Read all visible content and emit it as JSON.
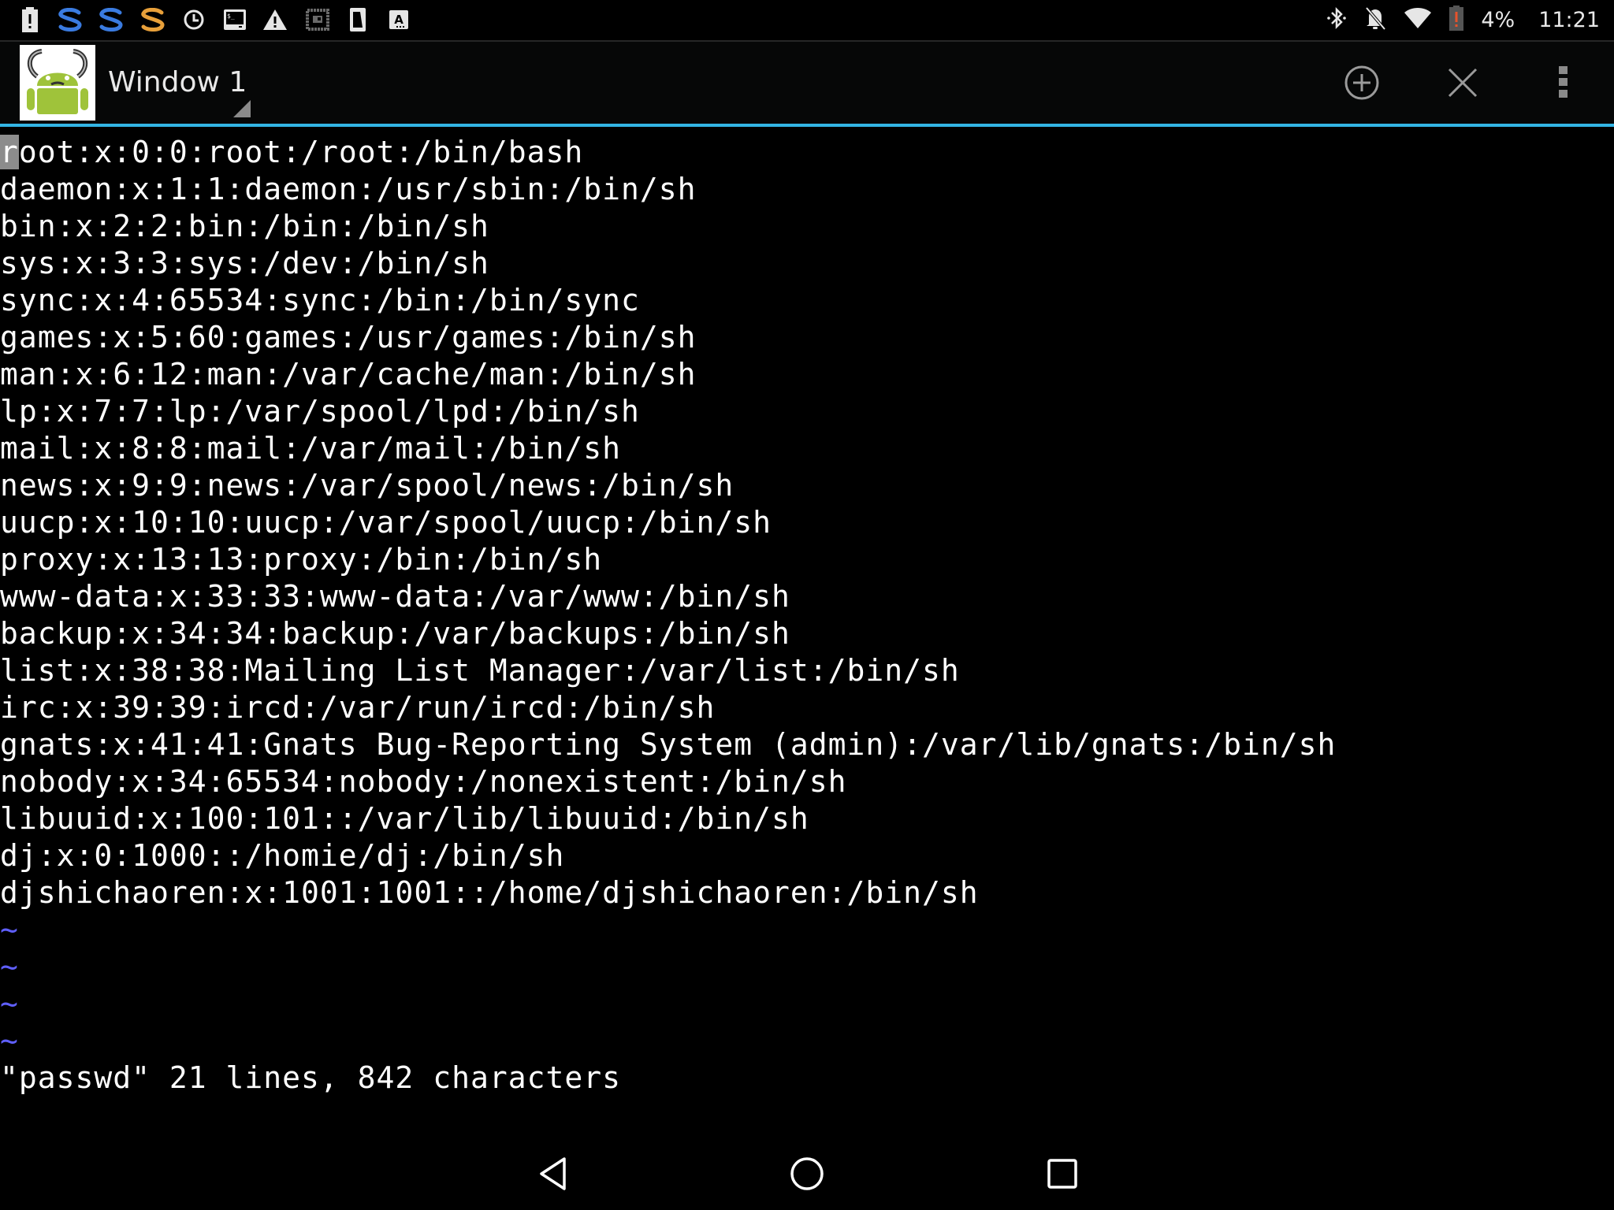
{
  "status_bar": {
    "left_icons": [
      {
        "name": "battery-alert-icon"
      },
      {
        "name": "s-app-icon-blue-1"
      },
      {
        "name": "s-app-icon-blue-2"
      },
      {
        "name": "s-app-icon-orange"
      },
      {
        "name": "clock-icon"
      },
      {
        "name": "terminal-icon"
      },
      {
        "name": "warning-icon"
      },
      {
        "name": "picture-frame-icon"
      },
      {
        "name": "sim-card-icon"
      },
      {
        "name": "keyboard-input-icon"
      }
    ],
    "right_icons": [
      {
        "name": "bluetooth-icon"
      },
      {
        "name": "notifications-off-icon"
      },
      {
        "name": "wifi-icon"
      },
      {
        "name": "battery-low-icon"
      }
    ],
    "battery_percent": "4%",
    "time": "11:21",
    "colors": {
      "s_blue": "#3a7be0",
      "s_orange": "#e8a03a",
      "battery_alert": "#e8522a"
    }
  },
  "title_bar": {
    "window_title": "Window 1",
    "actions": [
      {
        "name": "new-window-button",
        "icon": "add-circle-icon"
      },
      {
        "name": "close-window-button",
        "icon": "close-icon"
      },
      {
        "name": "overflow-menu-button",
        "icon": "more-vert-icon"
      }
    ],
    "accent_color": "#33b5e5"
  },
  "terminal": {
    "cursor_char": "r",
    "first_line_rest": "oot:x:0:0:root:/root:/bin/bash",
    "lines": [
      "daemon:x:1:1:daemon:/usr/sbin:/bin/sh",
      "bin:x:2:2:bin:/bin:/bin/sh",
      "sys:x:3:3:sys:/dev:/bin/sh",
      "sync:x:4:65534:sync:/bin:/bin/sync",
      "games:x:5:60:games:/usr/games:/bin/sh",
      "man:x:6:12:man:/var/cache/man:/bin/sh",
      "lp:x:7:7:lp:/var/spool/lpd:/bin/sh",
      "mail:x:8:8:mail:/var/mail:/bin/sh",
      "news:x:9:9:news:/var/spool/news:/bin/sh",
      "uucp:x:10:10:uucp:/var/spool/uucp:/bin/sh",
      "proxy:x:13:13:proxy:/bin:/bin/sh",
      "www-data:x:33:33:www-data:/var/www:/bin/sh",
      "backup:x:34:34:backup:/var/backups:/bin/sh",
      "list:x:38:38:Mailing List Manager:/var/list:/bin/sh",
      "irc:x:39:39:ircd:/var/run/ircd:/bin/sh",
      "gnats:x:41:41:Gnats Bug-Reporting System (admin):/var/lib/gnats:/bin/sh",
      "nobody:x:34:65534:nobody:/nonexistent:/bin/sh",
      "libuuid:x:100:101::/var/lib/libuuid:/bin/sh",
      "dj:x:0:1000::/homie/dj:/bin/sh",
      "djshichaoren:x:1001:1001::/home/djshichaoren:/bin/sh"
    ],
    "empty_line_marker": "~",
    "empty_line_count": 4,
    "status_message": "\"passwd\" 21 lines, 842 characters",
    "tilde_color": "#5f5fff"
  },
  "nav_bar": {
    "buttons": [
      {
        "name": "back-button",
        "icon": "back-triangle-icon"
      },
      {
        "name": "home-button",
        "icon": "home-circle-icon"
      },
      {
        "name": "recents-button",
        "icon": "recents-square-icon"
      }
    ]
  }
}
